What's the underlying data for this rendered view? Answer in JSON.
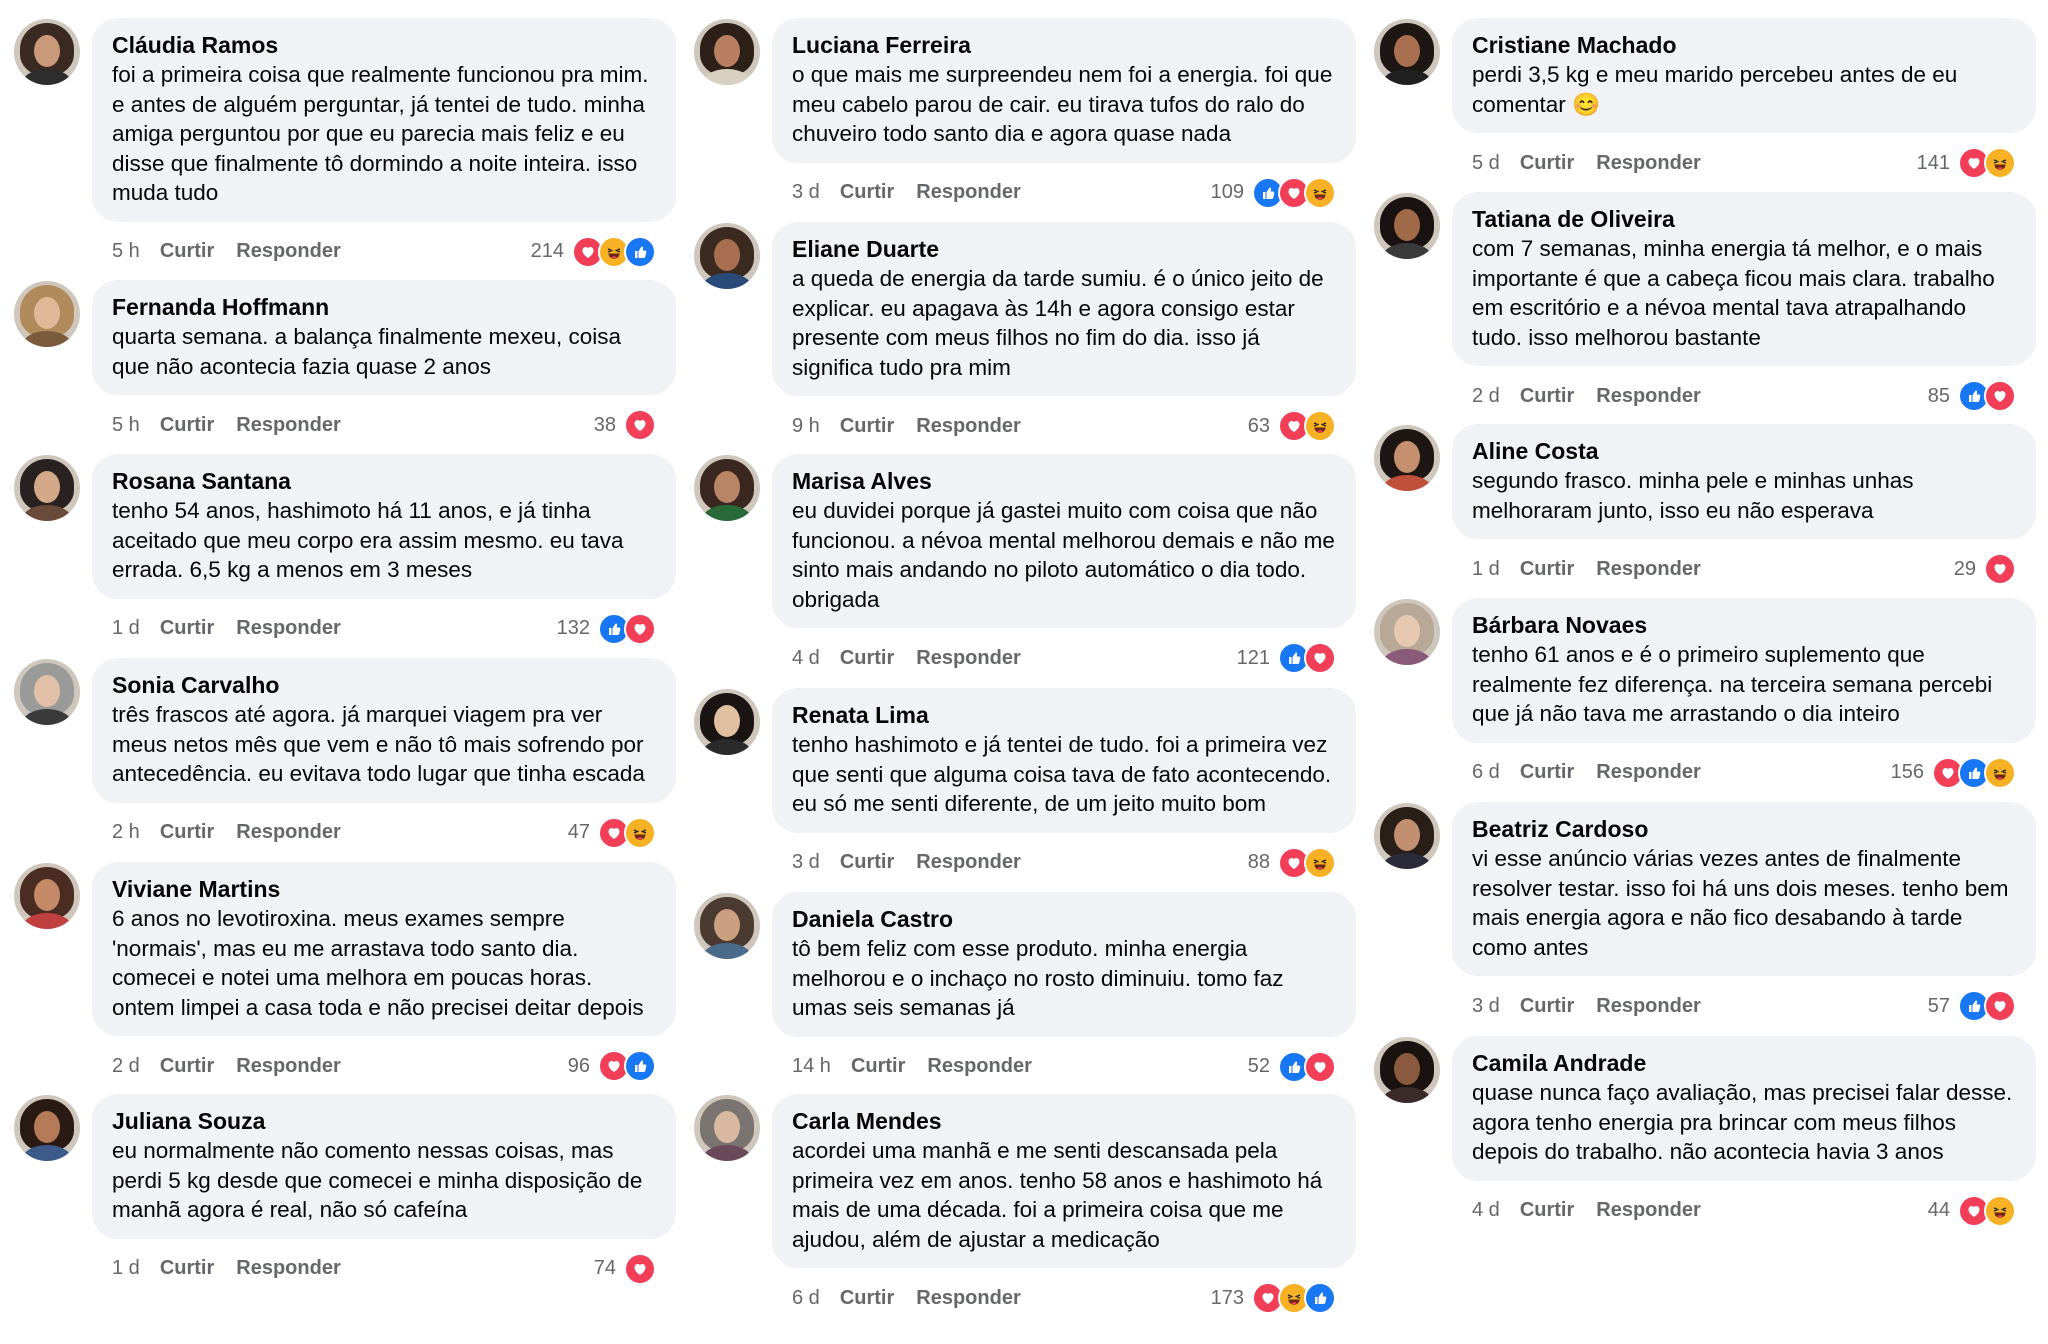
{
  "colors": {
    "bubble": "#f0f2f5",
    "meta_text": "#65676b",
    "like": "#1877f2",
    "love": "#f33e58",
    "haha": "#f7b125"
  },
  "actions": {
    "like": "Curtir",
    "reply": "Responder"
  },
  "columns": [
    {
      "comments": [
        {
          "name": "Cláudia Ramos",
          "text": "foi a primeira coisa que realmente funcionou pra mim.\ne antes de alguém perguntar, já tentei de tudo. minha\namiga perguntou por que eu parecia mais feliz e eu\ndisse que finalmente tô dormindo a noite inteira. isso\nmuda tudo",
          "time": "5 h",
          "count": "214",
          "reactions": [
            "love-icon",
            "haha-icon",
            "like-icon"
          ]
        },
        {
          "name": "Fernanda Hoffmann",
          "text": "quarta semana. a balança finalmente mexeu, coisa\nque não acontecia fazia quase 2 anos",
          "time": "5 h",
          "count": "38",
          "reactions": [
            "love-icon"
          ]
        },
        {
          "name": "Rosana Santana",
          "text": "tenho 54 anos, hashimoto há 11 anos, e já tinha\naceitado que meu corpo era assim mesmo. eu tava\nerrada. 6,5 kg a menos em 3 meses",
          "time": "1 d",
          "count": "132",
          "reactions": [
            "like-icon",
            "love-icon"
          ]
        },
        {
          "name": "Sonia Carvalho",
          "text": "três frascos até agora. já marquei viagem pra ver\nmeus netos mês que vem e não tô mais sofrendo por\nantecedência. eu evitava todo lugar que tinha escada",
          "time": "2 h",
          "count": "47",
          "reactions": [
            "love-icon",
            "haha-icon"
          ]
        },
        {
          "name": "Viviane Martins",
          "text": "6 anos no levotiroxina. meus exames sempre\n'normais', mas eu me arrastava todo santo dia.\ncomecei e notei uma melhora em poucas horas.\nontem limpei a casa toda e não precisei deitar depois",
          "time": "2 d",
          "count": "96",
          "reactions": [
            "love-icon",
            "like-icon"
          ]
        },
        {
          "name": "Juliana Souza",
          "text": "eu normalmente não comento nessas coisas, mas\nperdi 5 kg desde que comecei e minha disposição de\nmanhã agora é real, não só cafeína",
          "time": "1 d",
          "count": "74",
          "reactions": [
            "love-icon"
          ]
        }
      ]
    },
    {
      "comments": [
        {
          "name": "Luciana Ferreira",
          "text": "o que mais me surpreendeu nem foi a energia. foi que\nmeu cabelo parou de cair. eu tirava tufos do ralo do\nchuveiro todo santo dia e agora quase nada",
          "time": "3 d",
          "count": "109",
          "reactions": [
            "like-icon",
            "love-icon",
            "haha-icon"
          ]
        },
        {
          "name": "Eliane Duarte",
          "text": "a queda de energia da tarde sumiu. é o único jeito de\nexplicar. eu apagava às 14h e agora consigo estar\npresente com meus filhos no fim do dia. isso já\nsignifica tudo pra mim",
          "time": "9 h",
          "count": "63",
          "reactions": [
            "love-icon",
            "haha-icon"
          ]
        },
        {
          "name": "Marisa Alves",
          "text": "eu duvidei porque já gastei muito com coisa que não\nfuncionou. a névoa mental melhorou demais e não me\nsinto mais andando no piloto automático o dia todo.\nobrigada",
          "time": "4 d",
          "count": "121",
          "reactions": [
            "like-icon",
            "love-icon"
          ]
        },
        {
          "name": "Renata Lima",
          "text": "tenho hashimoto e já tentei de tudo. foi a primeira vez\nque senti que alguma coisa tava de fato acontecendo.\neu só me senti diferente, de um jeito muito bom",
          "time": "3 d",
          "count": "88",
          "reactions": [
            "love-icon",
            "haha-icon"
          ]
        },
        {
          "name": "Daniela Castro",
          "text": "tô bem feliz com esse produto. minha energia\nmelhorou e o inchaço no rosto diminuiu. tomo faz\numas seis semanas já",
          "time": "14 h",
          "count": "52",
          "reactions": [
            "like-icon",
            "love-icon"
          ]
        },
        {
          "name": "Carla Mendes",
          "text": "acordei uma manhã e me senti descansada pela\nprimeira vez em anos. tenho 58 anos e hashimoto há\nmais de uma década. foi a primeira coisa que me\najudou, além de ajustar a medicação",
          "time": "6 d",
          "count": "173",
          "reactions": [
            "love-icon",
            "haha-icon",
            "like-icon"
          ]
        }
      ]
    },
    {
      "comments": [
        {
          "name": "Cristiane Machado",
          "text": "perdi 3,5 kg e meu marido percebeu antes de eu\ncomentar 😊",
          "time": "5 d",
          "count": "141",
          "reactions": [
            "love-icon",
            "haha-icon"
          ]
        },
        {
          "name": "Tatiana de Oliveira",
          "text": "com 7 semanas, minha energia tá melhor, e o mais\nimportante é que a cabeça ficou mais clara. trabalho\nem escritório e a névoa mental tava atrapalhando\ntudo. isso melhorou bastante",
          "time": "2 d",
          "count": "85",
          "reactions": [
            "like-icon",
            "love-icon"
          ]
        },
        {
          "name": "Aline Costa",
          "text": "segundo frasco. minha pele e minhas unhas\nmelhoraram junto, isso eu não esperava",
          "time": "1 d",
          "count": "29",
          "reactions": [
            "love-icon"
          ]
        },
        {
          "name": "Bárbara Novaes",
          "text": "tenho 61 anos e é o primeiro suplemento que\nrealmente fez diferença. na terceira semana percebi\nque já não tava me arrastando o dia inteiro",
          "time": "6 d",
          "count": "156",
          "reactions": [
            "love-icon",
            "like-icon",
            "haha-icon"
          ]
        },
        {
          "name": "Beatriz Cardoso",
          "text": "vi esse anúncio várias vezes antes de finalmente\nresolver testar. isso foi há uns dois meses. tenho bem\nmais energia agora e não fico desabando à tarde\ncomo antes",
          "time": "3 d",
          "count": "57",
          "reactions": [
            "like-icon",
            "love-icon"
          ]
        },
        {
          "name": "Camila Andrade",
          "text": "quase nunca faço avaliação, mas precisei falar desse.\nagora tenho energia pra brincar com meus filhos\ndepois do trabalho. não acontecia havia 3 anos",
          "time": "4 d",
          "count": "44",
          "reactions": [
            "love-icon",
            "haha-icon"
          ]
        }
      ]
    }
  ]
}
